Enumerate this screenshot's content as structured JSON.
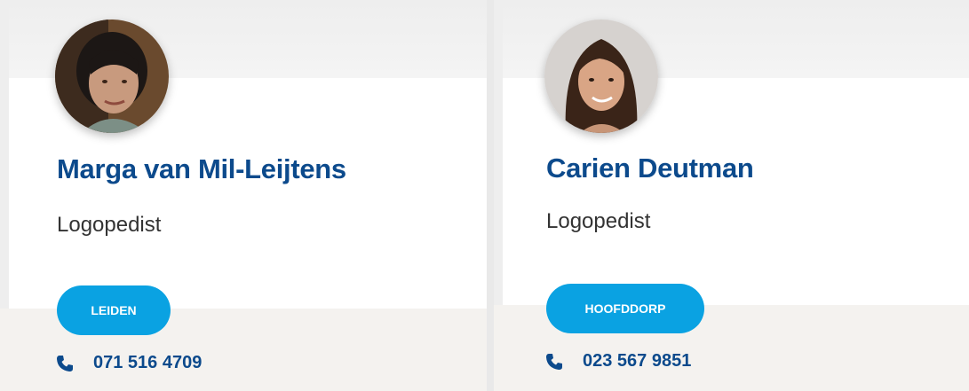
{
  "people": [
    {
      "name": "Marga van Mil-Leijtens",
      "role": "Logopedist",
      "location": "LEIDEN",
      "phone": "071 516 4709",
      "avatar_icon": "person-photo"
    },
    {
      "name": "Carien Deutman",
      "role": "Logopedist",
      "location": "HOOFDDORP",
      "phone": "023 567 9851",
      "avatar_icon": "person-photo"
    }
  ],
  "colors": {
    "name_blue": "#0c4a8c",
    "button_blue": "#0aa2e2",
    "footer_bg": "#f4f2ef",
    "text_dark": "#333333"
  }
}
